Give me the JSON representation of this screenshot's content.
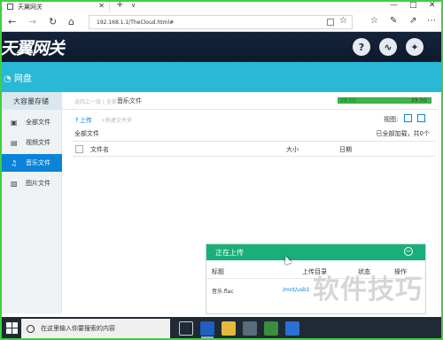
{
  "browser": {
    "tab_title": "天翼网关",
    "url": "192.168.1.1/TheCloud.html#",
    "nav": {
      "back": "←",
      "forward": "→",
      "refresh": "↻",
      "home": "⌂"
    },
    "window_controls": {
      "minimize": "—",
      "maximize": "□",
      "close": "✕"
    }
  },
  "app": {
    "logo": "天翼网关",
    "header_icons": [
      "help-icon",
      "network-icon",
      "settings-icon"
    ],
    "section_title": "网盘"
  },
  "left_nav": {
    "storage_label": "大容量存储",
    "items": [
      {
        "label": "全部文件",
        "icon": "cube-icon"
      },
      {
        "label": "视频文件",
        "icon": "film-icon"
      },
      {
        "label": "音乐文件",
        "icon": "music-icon"
      },
      {
        "label": "图片文件",
        "icon": "image-icon"
      }
    ]
  },
  "toolbar": {
    "breadcrumb_back": "返回上一级 | 全部文件",
    "breadcrumb_current": "音乐文件",
    "usage_used": "29.5G",
    "usage_total": "29.5G",
    "usage_fraction": 1.0
  },
  "main": {
    "upload_button": "上传",
    "new_folder": "新建文件夹",
    "view_label": "视图:",
    "current_folder": "全部文件",
    "loaded_status": "已全部加载，共0个",
    "columns": [
      "文件名",
      "大小",
      "日期"
    ]
  },
  "upload_panel": {
    "title": "正在上传",
    "minimize": "−",
    "columns": [
      "标题",
      "上传目录",
      "状态",
      "操作"
    ],
    "rows": [
      {
        "title": "音乐.flac",
        "directory": "/mnt/usb1"
      }
    ]
  },
  "watermark": "软件技巧",
  "taskbar": {
    "search_placeholder": "在这里输入你要搜索的内容"
  }
}
